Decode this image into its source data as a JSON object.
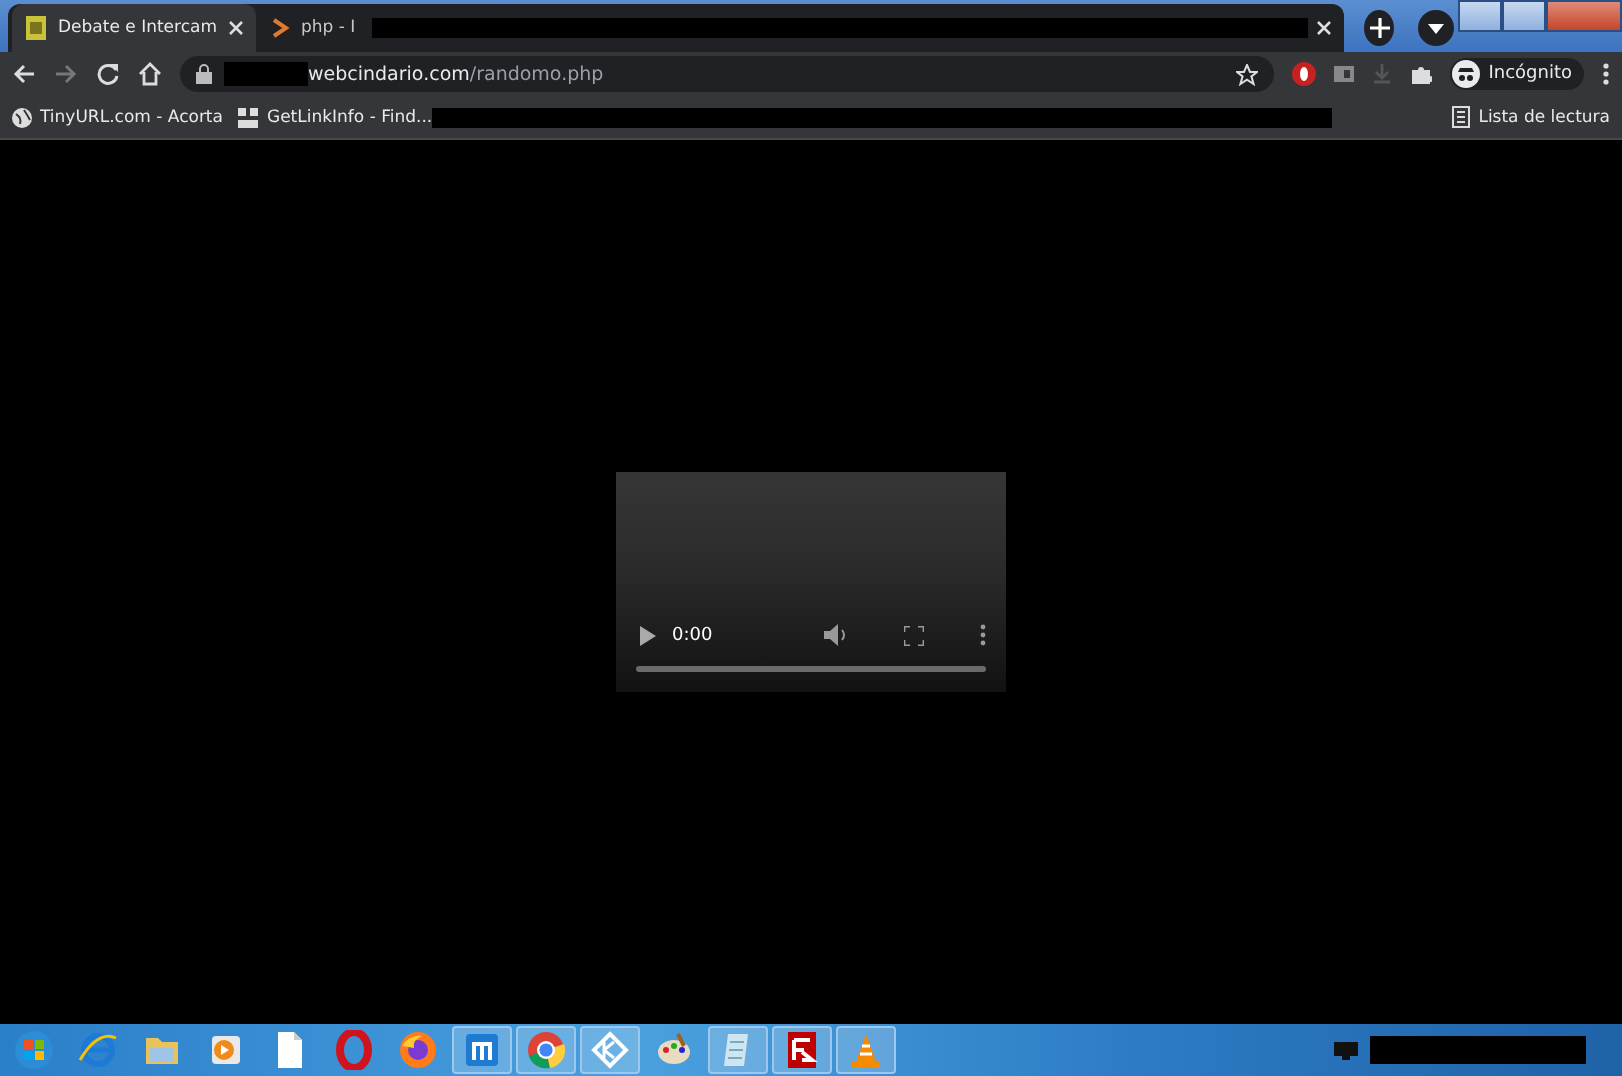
{
  "tabs": [
    {
      "label": "Debate e Intercam",
      "selected": true
    },
    {
      "label": "php - I",
      "selected": false
    }
  ],
  "address": {
    "host": "webcindario.com",
    "path": "/randomo.php"
  },
  "profile": {
    "label": "Incógnito"
  },
  "bookmarks": [
    {
      "label": "TinyURL.com - Acorta"
    },
    {
      "label": "GetLinkInfo - Find..."
    }
  ],
  "reading_list": {
    "label": "Lista de lectura"
  },
  "video": {
    "time": "0:00"
  },
  "taskbar": [
    {
      "kind": "start",
      "active": false
    },
    {
      "kind": "ie",
      "active": false
    },
    {
      "kind": "folder",
      "active": false
    },
    {
      "kind": "player",
      "active": false
    },
    {
      "kind": "file",
      "active": false
    },
    {
      "kind": "opera",
      "active": false
    },
    {
      "kind": "firefox",
      "active": false
    },
    {
      "kind": "maxthon",
      "active": true
    },
    {
      "kind": "chrome",
      "active": true
    },
    {
      "kind": "kodi",
      "active": true
    },
    {
      "kind": "paint",
      "active": false
    },
    {
      "kind": "notes",
      "active": true
    },
    {
      "kind": "filezilla",
      "active": true
    },
    {
      "kind": "vlc",
      "active": true
    }
  ]
}
